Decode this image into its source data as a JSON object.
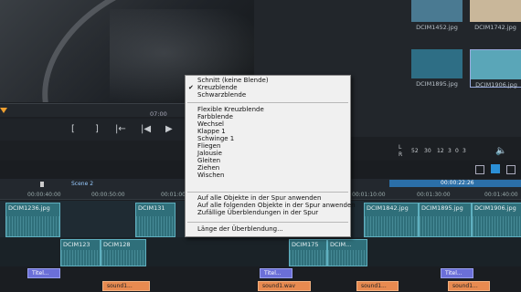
{
  "preview": {
    "timecode": "07:00"
  },
  "media_bin": {
    "items": [
      {
        "name": "DCIM1452.jpg",
        "color": "#4a7a92"
      },
      {
        "name": "DCIM1742.jpg",
        "color": "#c9b79a"
      },
      {
        "name": "DCIM1895.jpg",
        "color": "#2e6e85"
      },
      {
        "name": "DCIM1906.jpg",
        "color": "#5aa6b8"
      }
    ]
  },
  "transport": {
    "buttons": [
      "[",
      "]",
      "|←",
      "|◀",
      "▶"
    ]
  },
  "meter": {
    "left_label": "L",
    "right_label": "R",
    "scale": [
      "52",
      "30",
      "12",
      "3",
      "0",
      "3"
    ]
  },
  "timeline": {
    "scene_marker": "Scene 2",
    "end_timecode": "00:00:22:26",
    "ruler_ticks": [
      "00:00:40:00",
      "00:00:50:00",
      "00:01:00",
      "00:01:10:00",
      "00:01:30:00",
      "00:01:40:00",
      "00:01:50:00"
    ],
    "video_clips": [
      "DCIM1236.jpg",
      "DCIM131",
      "DCIM1842.jpg",
      "DCIM1895.jpg",
      "DCIM1906.jpg"
    ],
    "overlay_clips": [
      "DCIM123",
      "DCIM128",
      "DCIM175",
      "DCIM..."
    ],
    "title_clips": [
      "Titel...",
      "Titel...",
      "Titel..."
    ],
    "sound_clips": [
      "sound1...",
      "sound1.wav",
      "sound1...",
      "sound1..."
    ]
  },
  "context_menu": {
    "checked_item": "Kreuzblende",
    "group1": [
      "Schnitt (keine Blende)",
      "Kreuzblende",
      "Schwarzblende"
    ],
    "group2": [
      "Flexible Kreuzblende",
      "Farbblende",
      "Wechsel",
      "Klappe 1",
      "Schwinge 1",
      "Fliegen",
      "Jalousie",
      "Gleiten",
      "Ziehen",
      "Wischen"
    ],
    "group3": [
      "Auf alle Objekte in der Spur anwenden",
      "Auf alle folgenden Objekte in der Spur anwenden",
      "Zufällige Überblendungen in der Spur"
    ],
    "group4": [
      "Länge der Überblendung..."
    ]
  }
}
